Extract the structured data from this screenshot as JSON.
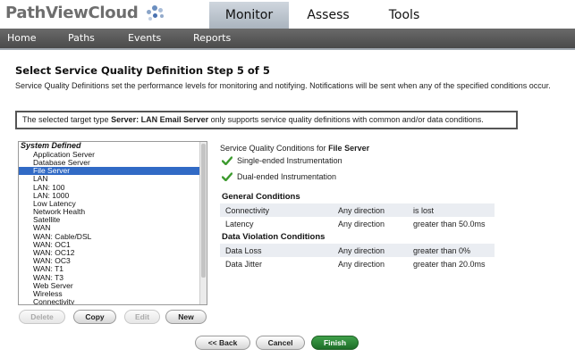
{
  "app": {
    "logo_text": "PathViewCloud"
  },
  "main_tabs": [
    {
      "label": "Monitor"
    },
    {
      "label": "Assess"
    },
    {
      "label": "Tools"
    }
  ],
  "nav": {
    "items": [
      {
        "label": "Home"
      },
      {
        "label": "Paths"
      },
      {
        "label": "Events"
      },
      {
        "label": "Reports"
      }
    ]
  },
  "page": {
    "title": "Select Service Quality Definition Step 5 of 5",
    "description": "Service Quality Definitions set the performance levels for monitoring and notifying. Notifications will be sent when any of the specified conditions occur.",
    "notice_prefix": "The selected target type ",
    "notice_target": "Server: LAN Email Server",
    "notice_suffix": " only supports service quality definitions with common and/or data conditions."
  },
  "definitions": {
    "group_label": "System Defined",
    "items": [
      "Application Server",
      "Database Server",
      "File Server",
      "LAN",
      "LAN: 100",
      "LAN: 1000",
      "Low Latency",
      "Network Health",
      "Satellite",
      "WAN",
      "WAN: Cable/DSL",
      "WAN: OC1",
      "WAN: OC12",
      "WAN: OC3",
      "WAN: T1",
      "WAN: T3",
      "Web Server",
      "Wireless",
      "Connectivity"
    ],
    "selected": "File Server"
  },
  "list_buttons": {
    "delete": "Delete",
    "copy": "Copy",
    "edit": "Edit",
    "new": "New"
  },
  "conditions": {
    "title_prefix": "Service Quality Conditions for ",
    "title_target": "File Server",
    "instrumentation": [
      "Single-ended Instrumentation",
      "Dual-ended Instrumentation"
    ],
    "general_heading": "General Conditions",
    "general_rows": [
      {
        "metric": "Connectivity",
        "direction": "Any direction",
        "condition": "is lost"
      },
      {
        "metric": "Latency",
        "direction": "Any direction",
        "condition": "greater than 50.0ms"
      }
    ],
    "data_heading": "Data Violation Conditions",
    "data_rows": [
      {
        "metric": "Data Loss",
        "direction": "Any direction",
        "condition": "greater than 0%"
      },
      {
        "metric": "Data Jitter",
        "direction": "Any direction",
        "condition": "greater than 20.0ms"
      }
    ]
  },
  "footer_buttons": {
    "back": "<< Back",
    "cancel": "Cancel",
    "finish": "Finish"
  },
  "colors": {
    "nav_bg": "#555555",
    "active_tab": "#bcc4cc",
    "selection": "#316ac5",
    "finish_green": "#2e8a38",
    "check_green": "#3c9a2e"
  }
}
